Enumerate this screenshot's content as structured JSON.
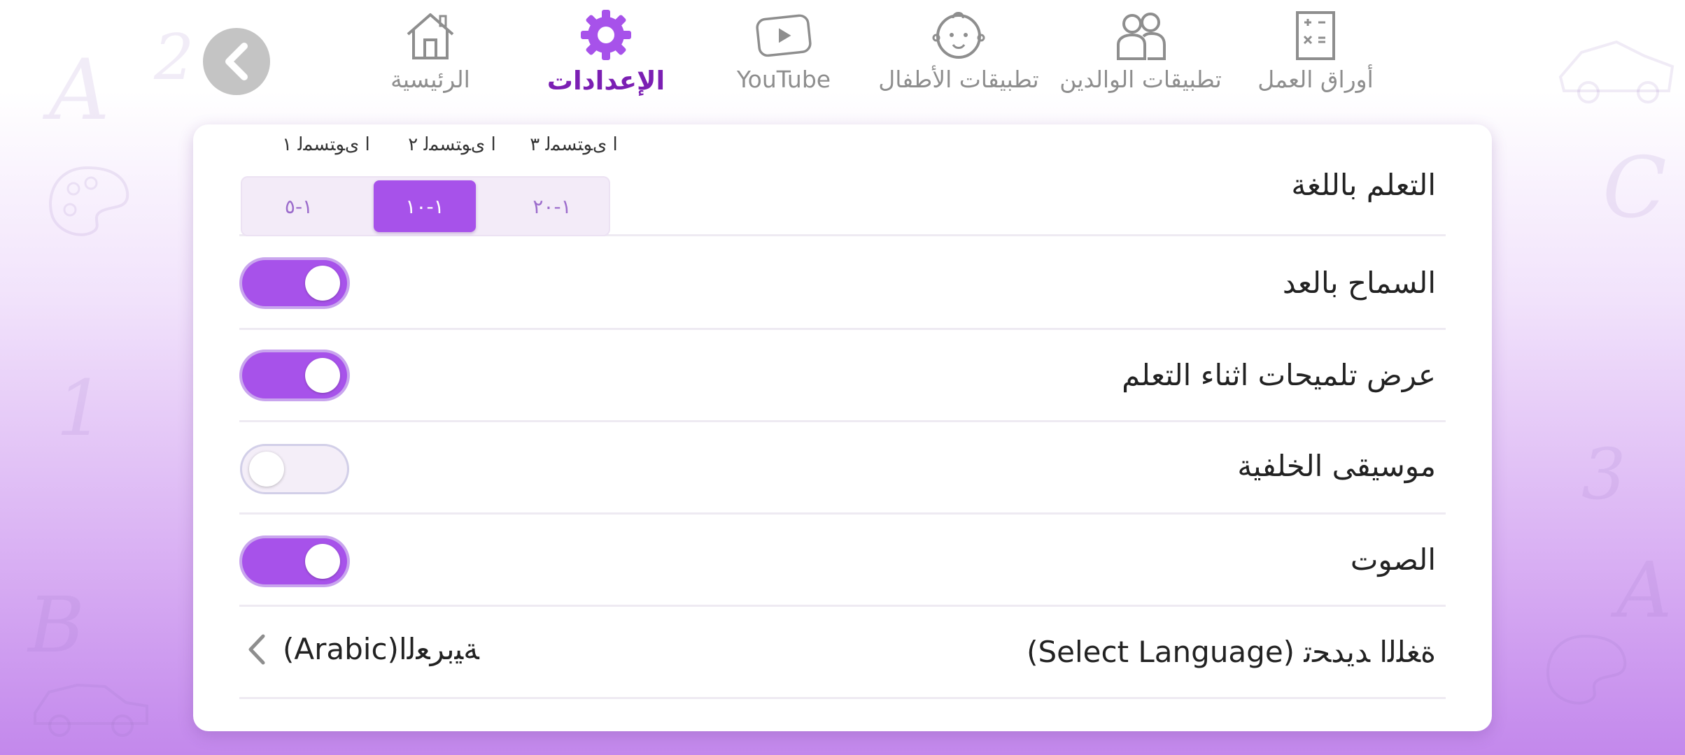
{
  "colors": {
    "accent": "#a752ea",
    "active_nav": "#7b1fb3",
    "inactive_nav": "#8e8e8e"
  },
  "nav": {
    "back_icon": "chevron-left-icon",
    "items": [
      {
        "label": "الرئيسية",
        "icon": "house-icon",
        "active": false
      },
      {
        "label": "الإعدادات",
        "icon": "gear-icon",
        "active": true
      },
      {
        "label": "YouTube",
        "icon": "youtube-icon",
        "active": false
      },
      {
        "label": "تطبيقات الأطفال",
        "icon": "baby-face-icon",
        "active": false
      },
      {
        "label": "تطبيقات الوالدين",
        "icon": "parents-icon",
        "active": false
      },
      {
        "label": "أوراق العمل",
        "icon": "worksheet-icon",
        "active": false
      }
    ]
  },
  "settings": {
    "learning": {
      "label": "التعلم باللغة",
      "levels": [
        "ا ﯼﻮﺘﺴﻤﻟ ٣",
        "ا ﯼﻮﺘﺴﻤﻟ ٢",
        "ا ﯼﻮﺘﺴﻤﻟ ١"
      ],
      "ranges": [
        "١-٢٠",
        "١-١٠",
        "١-٥"
      ],
      "selected_range": "١-١٠"
    },
    "allow_counting": {
      "label": "السماح بالعد",
      "on": true
    },
    "show_hints": {
      "label": "عرض تلميحات اثناء التعلم",
      "on": true
    },
    "background_music": {
      "label": "موسيقى الخلفية",
      "on": false
    },
    "sound": {
      "label": "الصوت",
      "on": true
    },
    "language": {
      "label": "(Select Language) ﺓﻐﻠﻟﺍ ﺪﻳﺪﺤﺗ",
      "value": "(Arabic)ﺔﻴﺑﺮﻌﻟﺍ",
      "chevron_icon": "chevron-left-icon"
    }
  }
}
